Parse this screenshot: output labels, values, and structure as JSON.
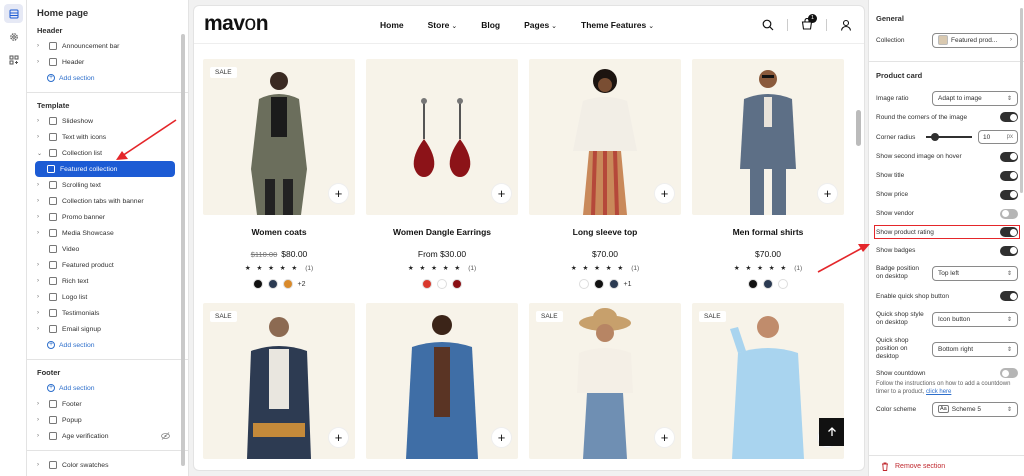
{
  "sidebar": {
    "title": "Home page",
    "header_group": {
      "heading": "Header",
      "items": [
        {
          "label": "Announcement bar"
        },
        {
          "label": "Header"
        }
      ],
      "add_label": "Add section"
    },
    "template_group": {
      "heading": "Template",
      "items": [
        {
          "label": "Slideshow"
        },
        {
          "label": "Text with icons"
        },
        {
          "label": "Collection list"
        },
        {
          "label": "Featured collection"
        },
        {
          "label": "Scrolling text"
        },
        {
          "label": "Collection tabs with banner"
        },
        {
          "label": "Promo banner"
        },
        {
          "label": "Media Showcase"
        },
        {
          "label": "Video"
        },
        {
          "label": "Featured product"
        },
        {
          "label": "Rich text"
        },
        {
          "label": "Logo list"
        },
        {
          "label": "Testimonials"
        },
        {
          "label": "Email signup"
        }
      ],
      "add_label": "Add section"
    },
    "footer_group": {
      "heading": "Footer",
      "add_label": "Add section",
      "items": [
        {
          "label": "Footer"
        },
        {
          "label": "Popup"
        },
        {
          "label": "Age verification"
        }
      ]
    },
    "bottom_item": {
      "label": "Color swatches"
    }
  },
  "store": {
    "logo_main": "mav",
    "logo_o": "o",
    "logo_end": "n",
    "nav": [
      {
        "label": "Home",
        "has_caret": false
      },
      {
        "label": "Store",
        "has_caret": true
      },
      {
        "label": "Blog",
        "has_caret": false
      },
      {
        "label": "Pages",
        "has_caret": true
      },
      {
        "label": "Theme Features",
        "has_caret": true
      }
    ],
    "cart_count": "1",
    "products": [
      {
        "name": "Women coats",
        "old_price": "$110.00",
        "price": "$80.00",
        "rating": "(1)",
        "sale": "SALE",
        "swatches": [
          "#111111",
          "#2b3a52",
          "#d98a2b"
        ],
        "more": "+2"
      },
      {
        "name": "Women Dangle Earrings",
        "old_price": "",
        "price": "From $30.00",
        "rating": "(1)",
        "sale": "",
        "swatches": [
          "#d9382c",
          "#ffffff",
          "#8a0f14"
        ],
        "more": ""
      },
      {
        "name": "Long sleeve top",
        "old_price": "",
        "price": "$70.00",
        "rating": "(1)",
        "sale": "",
        "swatches": [
          "#ffffff",
          "#111111",
          "#2b3a52"
        ],
        "more": "+1"
      },
      {
        "name": "Men formal shirts",
        "old_price": "",
        "price": "$70.00",
        "rating": "(1)",
        "sale": "",
        "swatches": [
          "#111111",
          "#2b3a52",
          "#ffffff"
        ],
        "more": ""
      }
    ],
    "row2_sale": [
      "SALE",
      "",
      "SALE",
      "SALE"
    ],
    "stars": "★ ★ ★ ★ ★"
  },
  "settings": {
    "general_heading": "General",
    "collection_label": "Collection",
    "collection_value": "Featured prod...",
    "product_card_heading": "Product card",
    "image_ratio_label": "Image ratio",
    "image_ratio_value": "Adapt to image",
    "round_corners_label": "Round the corners of the image",
    "corner_radius_label": "Corner radius",
    "corner_radius_value": "10",
    "corner_radius_unit": "px",
    "second_image_label": "Show second image on hover",
    "show_title_label": "Show title",
    "show_price_label": "Show price",
    "show_vendor_label": "Show vendor",
    "show_rating_label": "Show product rating",
    "show_badges_label": "Show badges",
    "badge_position_label": "Badge position on desktop",
    "badge_position_value": "Top left",
    "quick_shop_label": "Enable quick shop button",
    "quick_shop_style_label": "Quick shop style on desktop",
    "quick_shop_style_value": "Icon button",
    "quick_shop_position_label": "Quick shop position on desktop",
    "quick_shop_position_value": "Bottom right",
    "countdown_label": "Show countdown",
    "countdown_note": "Follow the instructions on how to add a countdown timer to a product,",
    "countdown_link": "click here",
    "color_scheme_label": "Color scheme",
    "color_scheme_value": "Scheme 5",
    "remove_label": "Remove section"
  }
}
